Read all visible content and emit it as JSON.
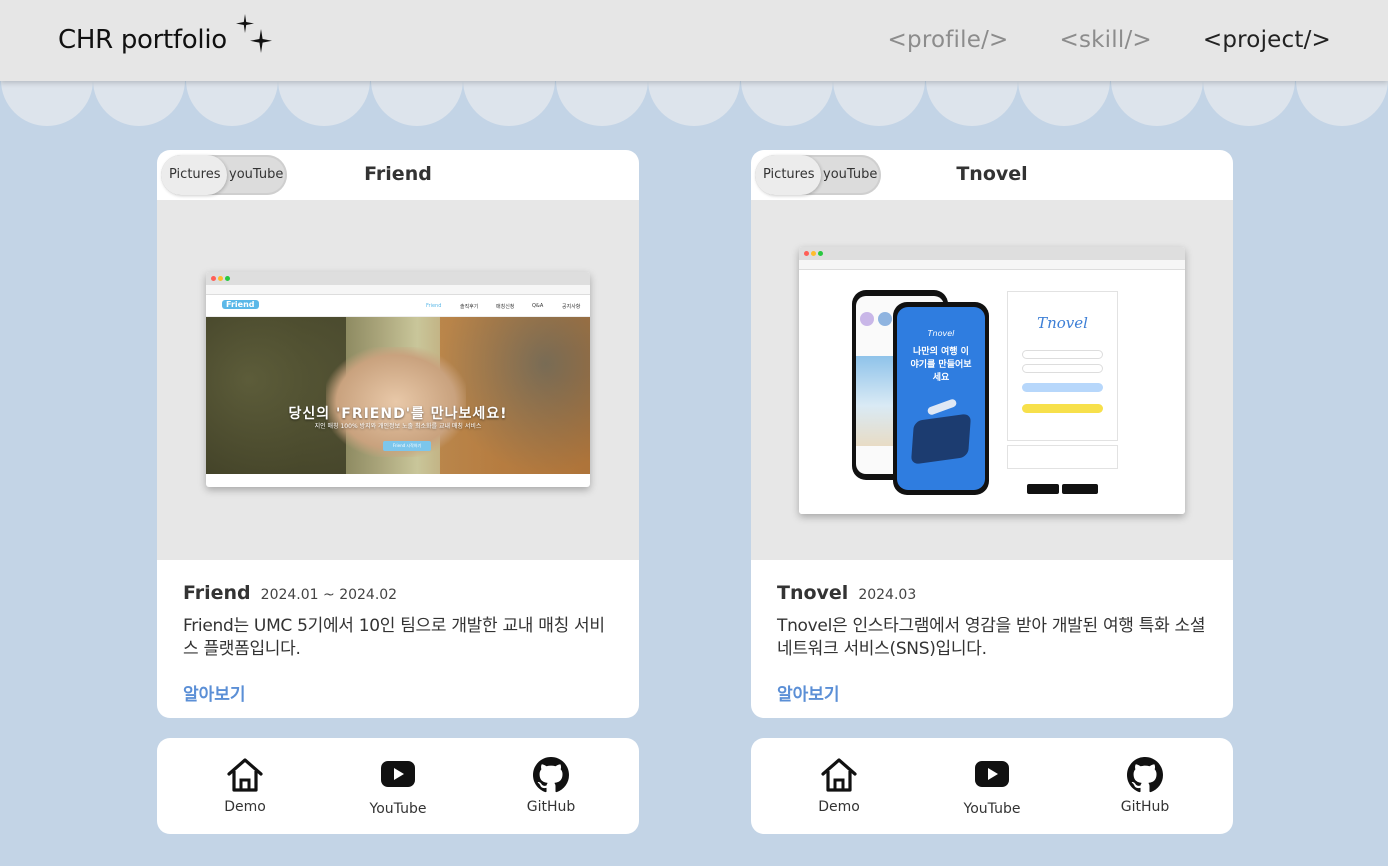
{
  "header": {
    "brand": "CHR portfolio",
    "nav": [
      {
        "label": "<profile/>",
        "active": false
      },
      {
        "label": "<skill/>",
        "active": false
      },
      {
        "label": "<project/>",
        "active": true
      }
    ]
  },
  "projects": [
    {
      "toggle": {
        "pictures": "Pictures",
        "youtube": "youTube"
      },
      "title": "Friend",
      "name": "Friend",
      "date": "2024.01 ~ 2024.02",
      "description": "Friend는 UMC 5기에서 10인 팀으로 개발한 교내 매칭 서비스 플랫폼입니다.",
      "more": "알아보기",
      "screenshot": {
        "logo": "Friend",
        "menu": [
          "Friend",
          "솔직후기",
          "매칭신청",
          "Q&A",
          "공지사항"
        ],
        "headline": "당신의 'FRIEND'를 만나보세요!",
        "subline": "지인 매칭 100% 방지와 개인정보 노출 최소화를 교내 매칭 서비스",
        "button": "Friend 시작하기"
      },
      "links": {
        "demo": "Demo",
        "youtube": "YouTube",
        "github": "GitHub"
      }
    },
    {
      "toggle": {
        "pictures": "Pictures",
        "youtube": "youTube"
      },
      "title": "Tnovel",
      "name": "Tnovel",
      "date": "2024.03",
      "description": "Tnovel은 인스타그램에서 영감을 받아 개발된 여행 특화 소셜 네트워크 서비스(SNS)입니다.",
      "more": "알아보기",
      "screenshot": {
        "logo": "Tnovel",
        "phone_logo": "Tnovel",
        "phone_text": "나만의 여행 이야기를 만들어보세요"
      },
      "links": {
        "demo": "Demo",
        "youtube": "YouTube",
        "github": "GitHub"
      }
    }
  ],
  "colors": {
    "background": "#c3d4e6",
    "header": "#e6e6e6",
    "accent": "#5b8fd6",
    "card": "#ffffff"
  },
  "icons": [
    "sparkle-icon",
    "home-icon",
    "youtube-icon",
    "github-icon"
  ]
}
